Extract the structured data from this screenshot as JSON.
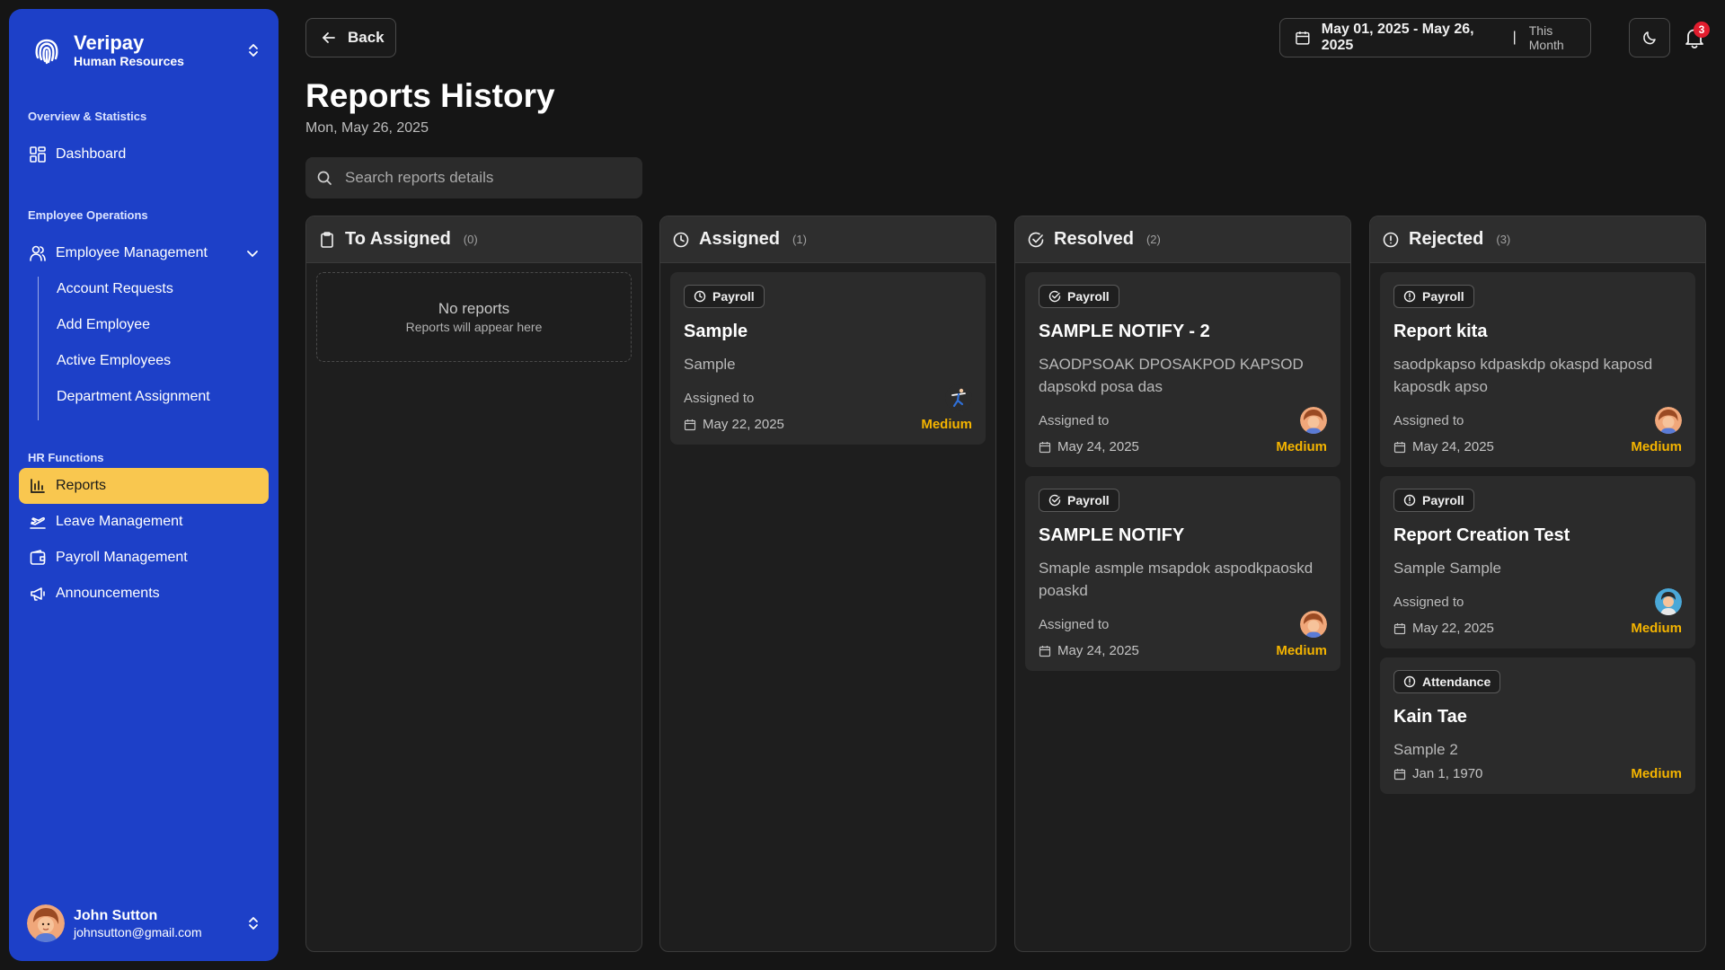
{
  "sidebar": {
    "brand_name": "Veripay",
    "brand_sub": "Human Resources",
    "sections": [
      "Overview & Statistics",
      "Employee Operations",
      "HR Functions"
    ],
    "dashboard": "Dashboard",
    "employee_management": "Employee Management",
    "sub_items": [
      "Account Requests",
      "Add Employee",
      "Active Employees",
      "Department Assignment"
    ],
    "reports": "Reports",
    "leave_management": "Leave Management",
    "payroll_management": "Payroll Management",
    "announcements": "Announcements",
    "user_name": "John Sutton",
    "user_email": "johnsutton@gmail.com"
  },
  "header": {
    "back_label": "Back",
    "title": "Reports History",
    "date": "Mon, May 26, 2025",
    "date_range": "May 01, 2025 - May 26, 2025",
    "separator": "|",
    "preset": "This Month",
    "notification_count": "3"
  },
  "search": {
    "placeholder": "Search reports details"
  },
  "columns": [
    {
      "title": "To Assigned",
      "count": "(0)",
      "empty_title": "No reports",
      "empty_sub": "Reports will appear here"
    },
    {
      "title": "Assigned",
      "count": "(1)"
    },
    {
      "title": "Resolved",
      "count": "(2)"
    },
    {
      "title": "Rejected",
      "count": "(3)"
    }
  ],
  "cards": {
    "assigned": [
      {
        "tag": "Payroll",
        "title": "Sample",
        "desc": "Sample",
        "assigned_label": "Assigned to",
        "date": "May 22, 2025",
        "priority": "Medium"
      }
    ],
    "resolved": [
      {
        "tag": "Payroll",
        "title": "SAMPLE NOTIFY - 2",
        "desc": "SAODPSOAK DPOSAKPOD KAPSOD dapsokd posa das",
        "assigned_label": "Assigned to",
        "date": "May 24, 2025",
        "priority": "Medium"
      },
      {
        "tag": "Payroll",
        "title": "SAMPLE NOTIFY",
        "desc": "Smaple asmple msapdok aspodkpaoskd poaskd",
        "assigned_label": "Assigned to",
        "date": "May 24, 2025",
        "priority": "Medium"
      }
    ],
    "rejected": [
      {
        "tag": "Payroll",
        "title": "Report kita",
        "desc": "saodpkapso kdpaskdp okaspd kaposd kaposdk apso",
        "assigned_label": "Assigned to",
        "date": "May 24, 2025",
        "priority": "Medium"
      },
      {
        "tag": "Payroll",
        "title": "Report Creation Test",
        "desc": "Sample Sample",
        "assigned_label": "Assigned to",
        "date": "May 22, 2025",
        "priority": "Medium"
      },
      {
        "tag": "Attendance",
        "title": "Kain Tae",
        "desc": "Sample 2",
        "date": "Jan 1, 1970",
        "priority": "Medium"
      }
    ]
  },
  "colors": {
    "sidebar_bg": "#1d40c8",
    "active_item": "#f9c74f",
    "priority": "#f4b400",
    "badge": "#e11d2e"
  }
}
